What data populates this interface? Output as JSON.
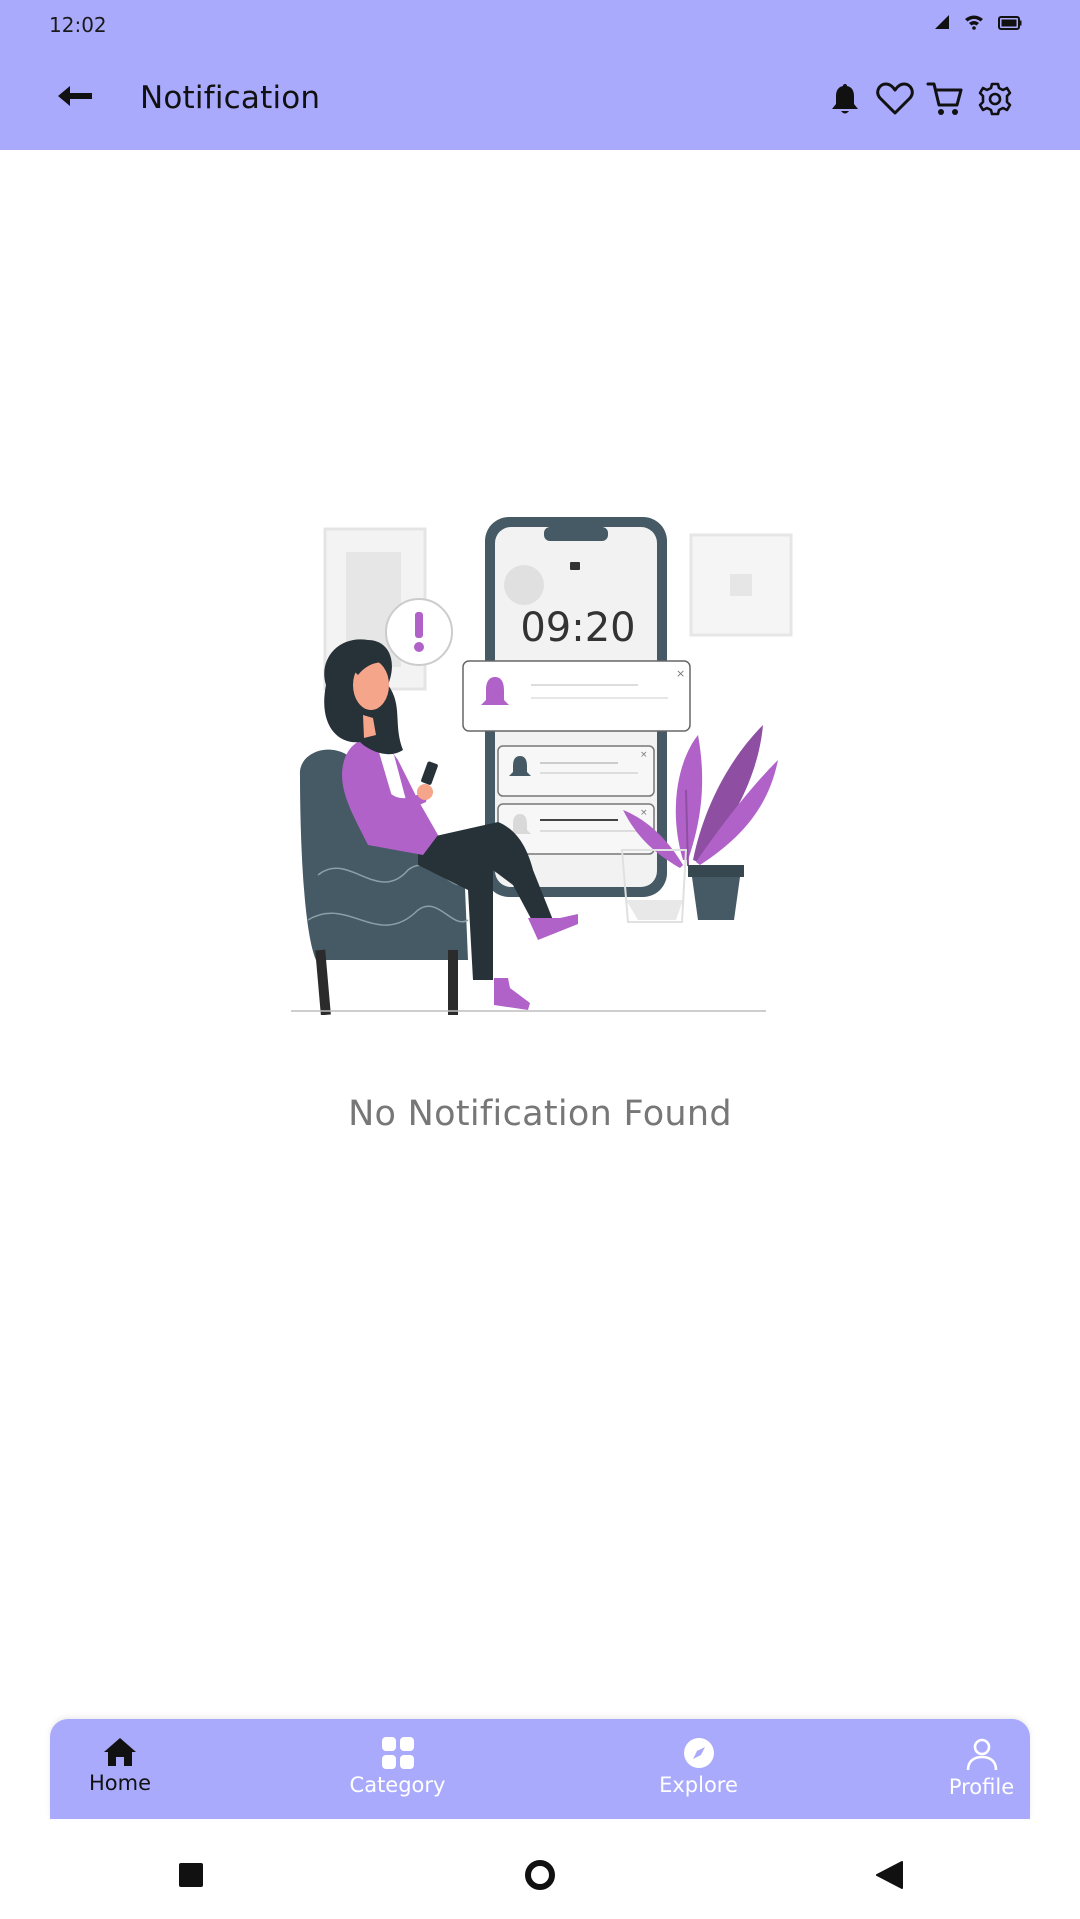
{
  "status_bar": {
    "time": "12:02",
    "icons": [
      "signal-icon",
      "wifi-icon",
      "battery-icon"
    ]
  },
  "app_bar": {
    "title": "Notification",
    "back_icon": "arrow-left-icon",
    "actions": [
      "bell-icon",
      "heart-icon",
      "cart-icon",
      "gear-icon"
    ]
  },
  "illustration": {
    "clock_text": "09:20"
  },
  "empty_state": {
    "message": "No Notification Found"
  },
  "bottom_nav": {
    "items": [
      {
        "label": "Home",
        "icon": "home-icon",
        "active": true
      },
      {
        "label": "Category",
        "icon": "grid-icon",
        "active": false
      },
      {
        "label": "Explore",
        "icon": "compass-icon",
        "active": false
      },
      {
        "label": "Profile",
        "icon": "person-icon",
        "active": false
      }
    ]
  },
  "colors": {
    "accent": "#aaaafd",
    "illustration_purple": "#b062c9",
    "illustration_dark": "#455a64"
  }
}
